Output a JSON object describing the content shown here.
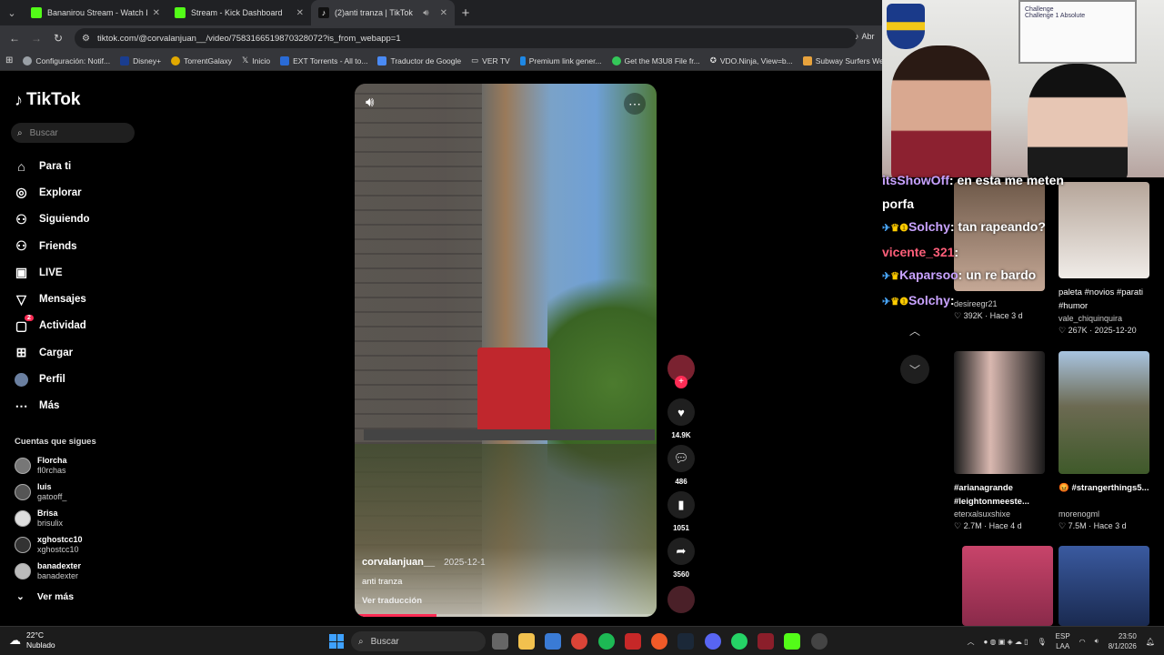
{
  "browser": {
    "tabs": [
      {
        "title": "Bananirou Stream - Watch Live",
        "color": "#53fc18"
      },
      {
        "title": "Stream - Kick Dashboard",
        "color": "#53fc18"
      },
      {
        "title": "(2)anti tranza | TikTok",
        "color": "#ffffff"
      }
    ],
    "url": "tiktok.com/@corvalanjuan__/video/7583166519870328072?is_from_webapp=1",
    "right_hint": "Abr",
    "bookmarks": [
      {
        "label": "Configuración: Notif...",
        "color": "#9aa0a6"
      },
      {
        "label": "Disney+",
        "color": "#1a3d8f"
      },
      {
        "label": "TorrentGalaxy",
        "color": "#e0a800"
      },
      {
        "label": "Inicio",
        "color": "#ffffff"
      },
      {
        "label": "EXT Torrents - All to...",
        "color": "#2a6bd6"
      },
      {
        "label": "Traductor de Google",
        "color": "#4a8af4"
      },
      {
        "label": "VER TV",
        "color": "#cccccc"
      },
      {
        "label": "Premium link gener...",
        "color": "#1e88e5"
      },
      {
        "label": "Get the M3U8 File fr...",
        "color": "#34c759"
      },
      {
        "label": "VDO.Ninja, View=b...",
        "color": "#dddddd"
      },
      {
        "label": "Subway Surfers Web",
        "color": "#e8a33d"
      }
    ]
  },
  "sidebar": {
    "logo": "TikTok",
    "search_placeholder": "Buscar",
    "items": [
      {
        "label": "Para ti",
        "icon": "home-icon",
        "glyph": "⌂"
      },
      {
        "label": "Explorar",
        "icon": "compass-icon",
        "glyph": "◎"
      },
      {
        "label": "Siguiendo",
        "icon": "user-follow-icon",
        "glyph": "⚇"
      },
      {
        "label": "Friends",
        "icon": "friends-icon",
        "glyph": "⚇"
      },
      {
        "label": "LIVE",
        "icon": "live-icon",
        "glyph": "▣"
      },
      {
        "label": "Mensajes",
        "icon": "send-icon",
        "glyph": "▽"
      },
      {
        "label": "Actividad",
        "icon": "activity-icon",
        "glyph": "▢",
        "badge": "2"
      },
      {
        "label": "Cargar",
        "icon": "upload-icon",
        "glyph": "⊞"
      },
      {
        "label": "Perfil",
        "icon": "profile-icon",
        "glyph": "●"
      },
      {
        "label": "Más",
        "icon": "more-icon",
        "glyph": "⋯"
      }
    ],
    "following_title": "Cuentas que sigues",
    "following": [
      {
        "name": "Florcha",
        "handle": "fl0rchas"
      },
      {
        "name": "luis",
        "handle": "gatooff_"
      },
      {
        "name": "Brisa",
        "handle": "brisulix"
      },
      {
        "name": "xghostcc10",
        "handle": "xghostcc10"
      },
      {
        "name": "banadexter",
        "handle": "banadexter"
      }
    ],
    "see_more": "Ver más"
  },
  "video": {
    "username": "corvalanjuan__",
    "date": "2025-12-1",
    "description": "anti tranza",
    "translate": "Ver traducción",
    "progress": 0.27,
    "likes": "14.9K",
    "comments": "486",
    "saves": "1051",
    "shares": "3560"
  },
  "grid": [
    {
      "title": "",
      "author": "desireegr21",
      "likes": "392K",
      "date": "Hace 3 d"
    },
    {
      "title": "paleta #novios #parati #humor",
      "author": "vale_chiquinquira",
      "likes": "267K",
      "date": "2025-12-20"
    },
    {
      "title": "#arianagrande #leightonmeeste...",
      "author": "eterxalsuxshixe",
      "likes": "2.7M",
      "date": "Hace 4 d"
    },
    {
      "title": "😡 #strangerthings5...",
      "author": "morenogml",
      "likes": "7.5M",
      "date": "Hace 3 d"
    }
  ],
  "chat": [
    {
      "user": "itsShowOff",
      "msg": ": en esta me meten",
      "color": "#c8a2ff"
    },
    {
      "user": "",
      "msg": "porfa",
      "color": "#ffffff"
    },
    {
      "user": "Solchy",
      "msg": ": tan rapeando?",
      "color": "#c8a2ff",
      "badges": true
    },
    {
      "user": "vicente_321",
      "msg": ":",
      "color": "#ff5f7a"
    },
    {
      "user": "Kaparsoo",
      "msg": ": un re bardo",
      "color": "#c8a2ff",
      "badges": true
    },
    {
      "user": "Solchy",
      "msg": ":",
      "color": "#c8a2ff",
      "badges": true
    }
  ],
  "cam": {
    "whiteboard": "Challenge\nChallenge 1 Absolute"
  },
  "taskbar": {
    "temp": "22°C",
    "weather": "Nublado",
    "search": "Buscar",
    "lang1": "ESP",
    "lang2": "LAA",
    "time": "23:50",
    "date": "8/1/2026"
  }
}
